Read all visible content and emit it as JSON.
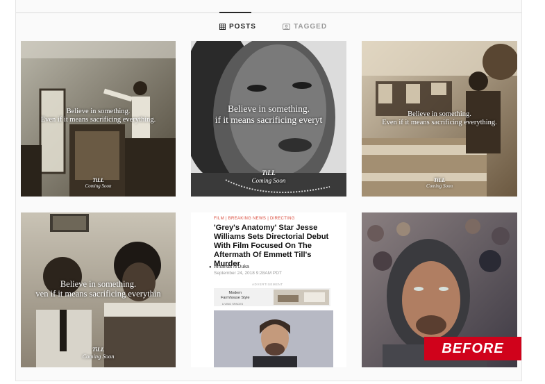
{
  "tabs": [
    {
      "label": "POSTS",
      "icon": "grid-icon",
      "active": true
    },
    {
      "label": "TAGGED",
      "icon": "tag-icon",
      "active": false
    }
  ],
  "overlay": {
    "line1": "Believe in something.",
    "line2": "Even if it means sacrificing everything.",
    "line2_cropped": "if it means sacrificing everyt",
    "line2_cropped_b": "ven if it means sacrificing everythin",
    "title": "TiLL",
    "subtitle": "Coming Soon"
  },
  "article": {
    "category": "FILM | BREAKING NEWS | DIRECTING",
    "headline": "'Grey's Anatomy' Star Jesse Williams Sets Directorial Debut With Film Focused On The Aftermath Of Emmett Till's Murder",
    "author": "Amanda N'Duka",
    "date": "September 24, 2018 9:28AM PDT",
    "ad_label": "ADVERTISEMENT",
    "ad_text_1": "Modern",
    "ad_text_2": "Farmhouse Style",
    "ad_cta": "LIVING SPACES"
  },
  "badge": {
    "label": "BEFORE",
    "color": "#d0021b"
  }
}
